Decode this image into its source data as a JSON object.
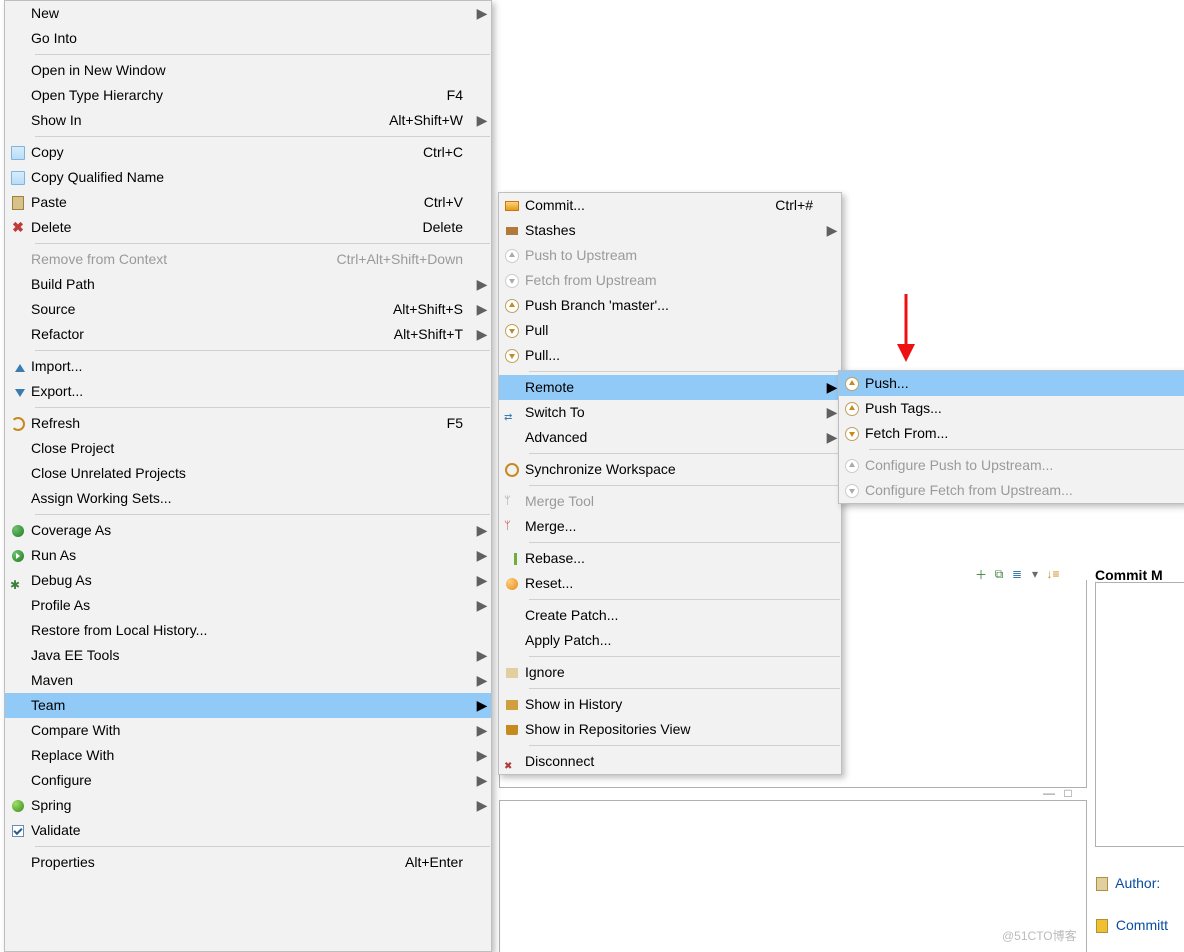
{
  "context_menu": {
    "items": [
      {
        "label": "New",
        "sub": true
      },
      {
        "label": "Go Into"
      },
      {
        "sep": true
      },
      {
        "label": "Open in New Window"
      },
      {
        "label": "Open Type Hierarchy",
        "accel": "F4"
      },
      {
        "label": "Show In",
        "accel": "Alt+Shift+W",
        "sub": true
      },
      {
        "sep": true
      },
      {
        "label": "Copy",
        "accel": "Ctrl+C",
        "icon": "copy"
      },
      {
        "label": "Copy Qualified Name",
        "icon": "copy"
      },
      {
        "label": "Paste",
        "accel": "Ctrl+V",
        "icon": "paste"
      },
      {
        "label": "Delete",
        "accel": "Delete",
        "icon": "delete"
      },
      {
        "sep": true
      },
      {
        "label": "Remove from Context",
        "accel": "Ctrl+Alt+Shift+Down",
        "disabled": true
      },
      {
        "label": "Build Path",
        "sub": true
      },
      {
        "label": "Source",
        "accel": "Alt+Shift+S",
        "sub": true
      },
      {
        "label": "Refactor",
        "accel": "Alt+Shift+T",
        "sub": true
      },
      {
        "sep": true
      },
      {
        "label": "Import...",
        "icon": "import"
      },
      {
        "label": "Export...",
        "icon": "export"
      },
      {
        "sep": true
      },
      {
        "label": "Refresh",
        "accel": "F5",
        "icon": "refresh"
      },
      {
        "label": "Close Project"
      },
      {
        "label": "Close Unrelated Projects"
      },
      {
        "label": "Assign Working Sets..."
      },
      {
        "sep": true
      },
      {
        "label": "Coverage As",
        "sub": true,
        "icon": "coverage"
      },
      {
        "label": "Run As",
        "sub": true,
        "icon": "run"
      },
      {
        "label": "Debug As",
        "sub": true,
        "icon": "debug"
      },
      {
        "label": "Profile As",
        "sub": true
      },
      {
        "label": "Restore from Local History..."
      },
      {
        "label": "Java EE Tools",
        "sub": true
      },
      {
        "label": "Maven",
        "sub": true
      },
      {
        "label": "Team",
        "sub": true,
        "hl": true
      },
      {
        "label": "Compare With",
        "sub": true
      },
      {
        "label": "Replace With",
        "sub": true
      },
      {
        "label": "Configure",
        "sub": true
      },
      {
        "label": "Spring",
        "sub": true,
        "icon": "spring"
      },
      {
        "label": "Validate",
        "icon": "check"
      },
      {
        "sep": true
      },
      {
        "label": "Properties",
        "accel": "Alt+Enter"
      }
    ]
  },
  "team_submenu": {
    "items": [
      {
        "label": "Commit...",
        "accel": "Ctrl+#",
        "icon": "git-orange"
      },
      {
        "label": "Stashes",
        "sub": true,
        "icon": "git-stash"
      },
      {
        "label": "Push to Upstream",
        "disabled": true,
        "icon": "git-uparr2"
      },
      {
        "label": "Fetch from Upstream",
        "disabled": true,
        "icon": "git-dn2"
      },
      {
        "label": "Push Branch 'master'...",
        "icon": "git-uparr"
      },
      {
        "label": "Pull",
        "icon": "git-dn"
      },
      {
        "label": "Pull...",
        "icon": "git-dn"
      },
      {
        "sep": true
      },
      {
        "label": "Remote",
        "sub": true,
        "hl": true
      },
      {
        "label": "Switch To",
        "sub": true,
        "icon": "git-switch"
      },
      {
        "label": "Advanced",
        "sub": true
      },
      {
        "sep": true
      },
      {
        "label": "Synchronize Workspace",
        "icon": "git-sync"
      },
      {
        "sep": true
      },
      {
        "label": "Merge Tool",
        "disabled": true,
        "icon": "git-merge-g"
      },
      {
        "label": "Merge...",
        "icon": "git-merge"
      },
      {
        "sep": true
      },
      {
        "label": "Rebase...",
        "icon": "git-rebase"
      },
      {
        "label": "Reset...",
        "icon": "git-orangeball"
      },
      {
        "sep": true
      },
      {
        "label": "Create Patch..."
      },
      {
        "label": "Apply Patch..."
      },
      {
        "sep": true
      },
      {
        "label": "Ignore",
        "icon": "git-ignore"
      },
      {
        "sep": true
      },
      {
        "label": "Show in History",
        "icon": "git-hist"
      },
      {
        "label": "Show in Repositories View",
        "icon": "git-repo"
      },
      {
        "sep": true
      },
      {
        "label": "Disconnect",
        "icon": "git-disc"
      }
    ]
  },
  "remote_submenu": {
    "items": [
      {
        "label": "Push...",
        "hl": true,
        "icon": "git-uparr"
      },
      {
        "label": "Push Tags...",
        "icon": "git-uparr"
      },
      {
        "label": "Fetch From...",
        "icon": "git-dn"
      },
      {
        "sep": true
      },
      {
        "label": "Configure Push to Upstream...",
        "disabled": true,
        "icon": "git-uparr2"
      },
      {
        "label": "Configure Fetch from Upstream...",
        "disabled": true,
        "icon": "git-dn2"
      }
    ]
  },
  "background": {
    "commit_heading": "Commit M",
    "author_label": "Author:",
    "committer_label": "Committ",
    "watermark": "@51CTO博客"
  }
}
